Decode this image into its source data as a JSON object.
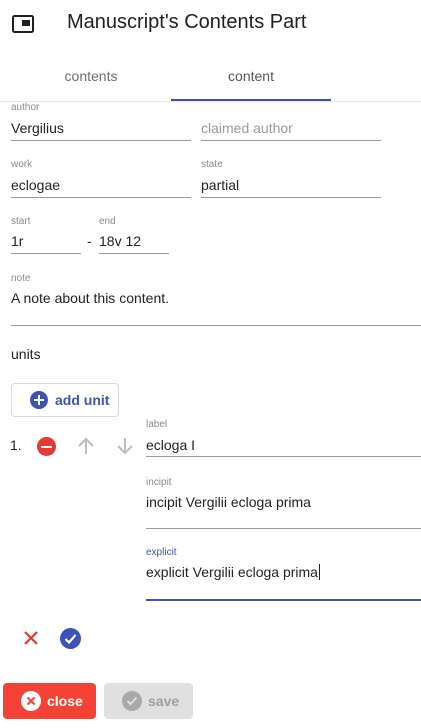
{
  "header": {
    "title": "Manuscript's Contents Part",
    "icon": "window-icon"
  },
  "tabs": [
    {
      "label": "contents",
      "active": false
    },
    {
      "label": "content",
      "active": true
    }
  ],
  "form": {
    "author": {
      "label": "author",
      "value": "Vergilius"
    },
    "claimed_author": {
      "placeholder": "claimed author"
    },
    "work": {
      "label": "work",
      "value": "eclogae"
    },
    "state": {
      "label": "state",
      "value": "partial"
    },
    "start": {
      "label": "start",
      "value": "1r"
    },
    "range_separator": "-",
    "end": {
      "label": "end",
      "value": "18v 12"
    },
    "note": {
      "label": "note",
      "value": "A note about this content."
    }
  },
  "units": {
    "title": "units",
    "add_label": "add unit",
    "items": [
      {
        "number": "1.",
        "label_caption": "label",
        "label_value": "ecloga I",
        "incipit_caption": "incipit",
        "incipit_value": "incipit Vergilii ecloga prima",
        "explicit_caption": "explicit",
        "explicit_value": "explicit Vergilii ecloga prima"
      }
    ]
  },
  "buttons": {
    "close": "close",
    "save": "save"
  },
  "colors": {
    "primary": "#3f51b5",
    "danger": "#f44336",
    "disabled": "#e0e0e0"
  }
}
